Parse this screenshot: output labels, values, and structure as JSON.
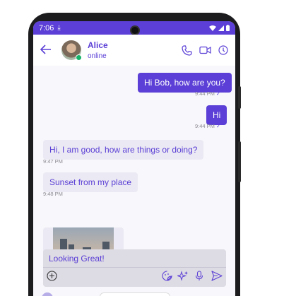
{
  "status_bar": {
    "time": "7:06",
    "download_icon": "download-icon",
    "wifi_icon": "wifi-icon",
    "signal_icon": "signal-icon",
    "battery_icon": "battery-icon"
  },
  "header": {
    "contact_name": "Alice",
    "contact_status": "online",
    "back_icon": "arrow-left-icon",
    "actions": [
      "phone-icon",
      "video-icon",
      "info-icon"
    ]
  },
  "messages": [
    {
      "direction": "out",
      "text": "Hi Bob, how are you?",
      "time": "9:44 PM",
      "status": "read"
    },
    {
      "direction": "out",
      "text": "Hi",
      "time": "9:44 PM",
      "status": "read"
    },
    {
      "direction": "in",
      "text": "Hi, I am good, how are things or doing?",
      "time": "9:47 PM"
    },
    {
      "direction": "in",
      "text": "Sunset from my place",
      "time": "9:48 PM"
    },
    {
      "direction": "in",
      "type": "image",
      "content": "photo-of-city-sunset"
    }
  ],
  "composer": {
    "value": "Looking Great!",
    "icons": [
      "plus-circle-icon",
      "sticker-icon",
      "ai-sparkle-icon",
      "microphone-icon",
      "send-icon"
    ]
  },
  "colors": {
    "accent": "#5b3fd6",
    "incoming_bubble": "#ebe9f3",
    "background": "#f8f7fb"
  }
}
